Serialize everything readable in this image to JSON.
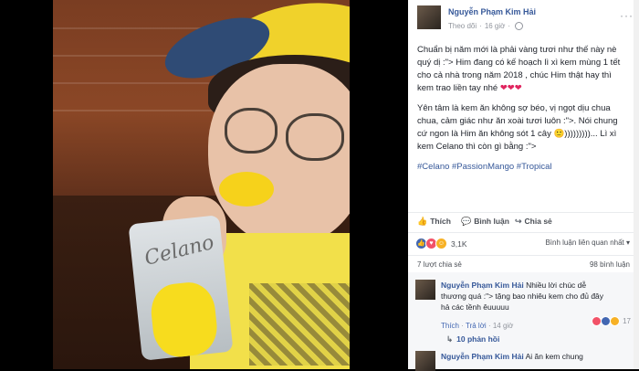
{
  "post": {
    "author": "Nguyễn Phạm Kim Hải",
    "follow": "Theo dõi",
    "time": "16 giờ",
    "more": "···",
    "caption_p1": "Chuẩn bị năm mới là phải vàng tươi như thế này nè quý dị :\"> Him đang có kế hoạch lì xì kem mùng 1 tết cho cả nhà trong năm 2018 , chúc Him thật hay thì kem trao liền tay nhé",
    "caption_p1_hearts": "❤❤❤",
    "caption_p2": "Yên tâm là kem ăn không sợ béo, vị ngọt dịu chua chua, cảm giác như ăn xoài tươi luôn :\">. Nói chung cứ ngon là Him ăn không sót 1 cây",
    "caption_p2_tail": "🙂)))))))))... Lì xì kem Celano thì còn gì bằng :\">",
    "hashtags": "#Celano #PassionMango #Tropical"
  },
  "actions": {
    "like": "Thích",
    "comment": "Bình luận",
    "share": "Chia sẻ"
  },
  "reactions": {
    "count": "3,1K",
    "sort": "Bình luận liên quan nhất ▾"
  },
  "stats": {
    "shares": "7 lượt chia sẻ",
    "comments": "98 bình luận"
  },
  "comments": [
    {
      "name": "Nguyễn Phạm Kim Hải",
      "text": "Nhiều lời chúc dễ thương quá :\"> tặng bao nhiêu kem cho đủ đây hả các tềnh êuuuuu",
      "like": "Thích",
      "reply": "Trả lời",
      "time": "14 giờ",
      "reactions": "17",
      "replies": "10 phản hồi"
    },
    {
      "name": "Nguyễn Phạm Kim Hải",
      "text": "Ai ăn kem chung"
    }
  ],
  "photo": {
    "brand_text": "Celano"
  },
  "colors": {
    "link": "#365899",
    "text": "#1d2129",
    "muted": "#90949c",
    "heart": "#e0245e"
  }
}
